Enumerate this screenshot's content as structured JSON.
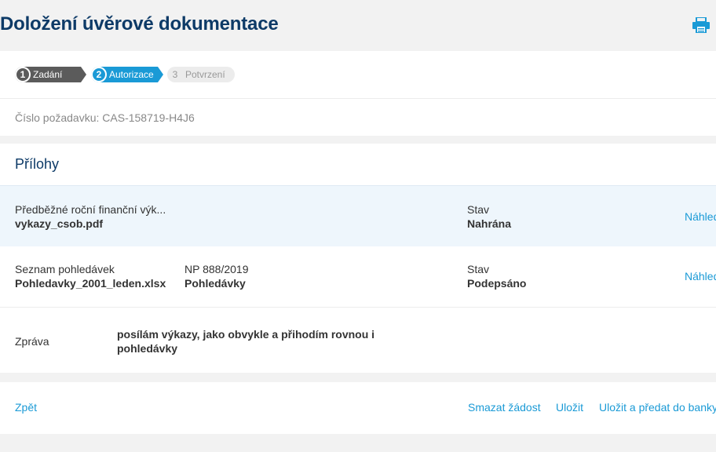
{
  "header": {
    "title": "Doložení úvěrové dokumentace",
    "print_icon": "printer-icon",
    "accent": "#1a9ad6",
    "title_color": "#0d3a67"
  },
  "stepper": {
    "steps": [
      {
        "number": "1",
        "label": "Zadání",
        "state": "done"
      },
      {
        "number": "2",
        "label": "Autorizace",
        "state": "active"
      },
      {
        "number": "3",
        "label": "Potvrzení",
        "state": "pending"
      }
    ]
  },
  "request": {
    "text": "Číslo požadavku: CAS-158719-H4J6"
  },
  "attachments": {
    "title": "Přílohy",
    "rows": [
      {
        "name": "Předběžné roční finanční výk...",
        "file": "vykazy_csob.pdf",
        "ref_label": "",
        "ref_value": "",
        "status_label": "Stav",
        "status_value": "Nahrána",
        "action": "Náhled"
      },
      {
        "name": "Seznam pohledávek",
        "file": "Pohledavky_2001_leden.xlsx",
        "ref_label": "NP 888/2019",
        "ref_value": "Pohledávky",
        "status_label": "Stav",
        "status_value": "Podepsáno",
        "action": "Náhled"
      }
    ],
    "message_label": "Zpráva",
    "message_text": "posílám výkazy, jako obvykle a přihodím rovnou i pohledávky"
  },
  "footer": {
    "back": "Zpět",
    "delete": "Smazat žádost",
    "save": "Uložit",
    "save_submit": "Uložit a předat do banky"
  }
}
